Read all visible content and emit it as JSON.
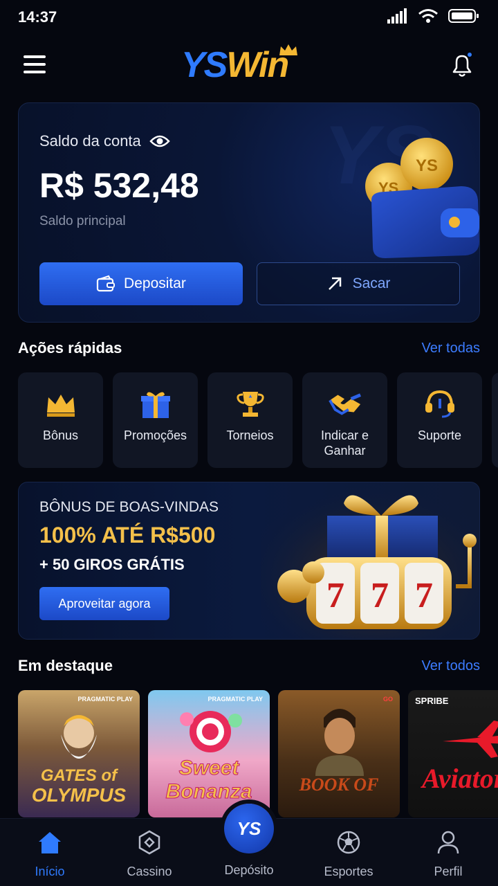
{
  "status_bar": {
    "time": "14:37"
  },
  "header": {
    "logo_left": "YS",
    "logo_right": "Win"
  },
  "balance": {
    "label": "Saldo da conta",
    "amount": "R$ 532,48",
    "sublabel": "Saldo principal",
    "deposit_label": "Depositar",
    "withdraw_label": "Sacar"
  },
  "quick_actions": {
    "title": "Ações rápidas",
    "see_all": "Ver todas",
    "items": [
      {
        "label": "Bônus",
        "icon": "crown-icon"
      },
      {
        "label": "Promoções",
        "icon": "gift-icon"
      },
      {
        "label": "Torneios",
        "icon": "trophy-icon"
      },
      {
        "label": "Indicar e Ganhar",
        "icon": "handshake-icon"
      },
      {
        "label": "Suporte",
        "icon": "headset-icon"
      }
    ]
  },
  "promo": {
    "kicker": "BÔNUS DE BOAS-VINDAS",
    "title": "100% ATÉ R$500",
    "subtitle": "+ 50 GIROS GRÁTIS",
    "cta": "Aproveitar agora"
  },
  "featured": {
    "title": "Em destaque",
    "see_all": "Ver todos",
    "games": [
      {
        "title_line1": "GATES of",
        "title_line2": "OLYMPUS",
        "provider": "PRAGMATIC PLAY"
      },
      {
        "title_line1": "Sweet",
        "title_line2": "Bonanza",
        "provider": "PRAGMATIC PLAY"
      },
      {
        "title_line1": "BOOK OF",
        "title_line2": "",
        "provider": "GO"
      },
      {
        "title_line1": "Aviator",
        "title_line2": "",
        "provider": "SPRIBE"
      }
    ]
  },
  "bottom_nav": {
    "items": [
      {
        "label": "Início"
      },
      {
        "label": "Cassino"
      },
      {
        "label": "Depósito",
        "badge": "YS"
      },
      {
        "label": "Esportes"
      },
      {
        "label": "Perfil"
      }
    ]
  },
  "colors": {
    "accent": "#2f7bff",
    "gold": "#f4c04a",
    "background": "#05070f"
  }
}
